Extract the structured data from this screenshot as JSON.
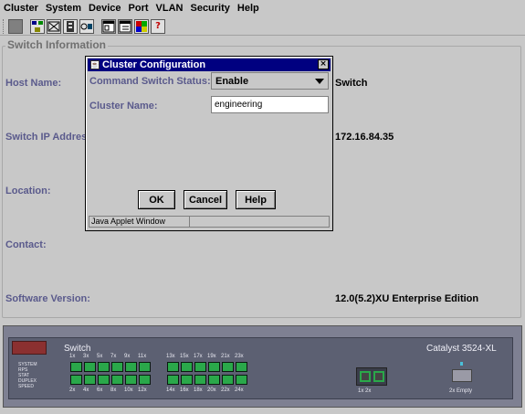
{
  "menu": [
    "Cluster",
    "System",
    "Device",
    "Port",
    "VLAN",
    "Security",
    "Help"
  ],
  "toolbar": {
    "icons": [
      "dots-icon",
      "cluster-icon",
      "device-icon",
      "port-icon",
      "vlan-icon",
      "properties-icon",
      "window-icon",
      "colors-icon",
      "help-icon"
    ],
    "help_glyph": "?"
  },
  "switch_info": {
    "title": "Switch Information",
    "host_label": "Host Name:",
    "host_value": "Switch",
    "ip_label": "Switch IP Address:",
    "ip_value": "172.16.84.35",
    "location_label": "Location:",
    "contact_label": "Contact:",
    "software_label": "Software Version:",
    "software_value": "12.0(5.2)XU Enterprise Edition"
  },
  "dialog": {
    "title": "Cluster Configuration",
    "close_glyph": "×",
    "status_label": "Command Switch Status:",
    "status_value": "Enable",
    "name_label": "Cluster Name:",
    "name_value": "engineering",
    "ok_label": "OK",
    "cancel_label": "Cancel",
    "help_label": "Help",
    "status_bar": "Java Applet Window"
  },
  "device": {
    "name": "Switch",
    "model": "Catalyst 3524-XL",
    "top_port_labels": [
      "1x",
      "3x",
      "5x",
      "7x",
      "9x",
      "11x",
      "13x",
      "15x",
      "17x",
      "19x",
      "21x",
      "23x"
    ],
    "bottom_port_labels": [
      "2x",
      "4x",
      "6x",
      "8x",
      "10x",
      "12x",
      "14x",
      "16x",
      "18x",
      "20x",
      "22x",
      "24x"
    ],
    "gbic_label": "1x 2x",
    "empty_label": "2x Empty",
    "led_labels": [
      "SYSTEM",
      "RPS",
      "STAT",
      "DUPLEX",
      "SPEED"
    ],
    "port_up_color": "#2aa84a"
  }
}
